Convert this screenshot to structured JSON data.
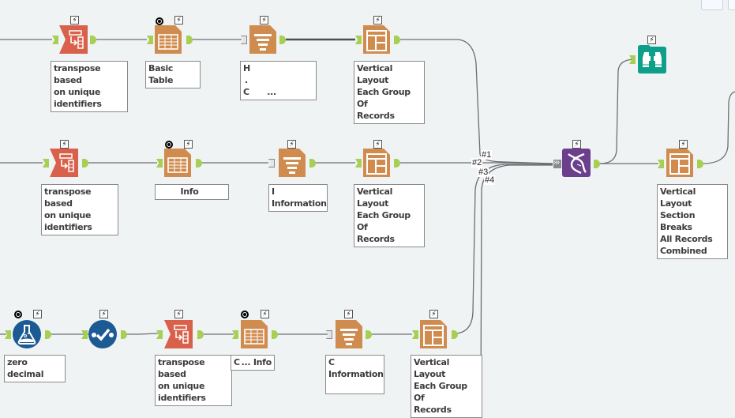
{
  "canvas": {
    "background": "#f0f3f4",
    "colors": {
      "transpose": "#d9604a",
      "reporting": "#d08b4f",
      "union": "#6b3f8c",
      "browse": "#0e9f8b",
      "prep": "#1b5a92",
      "anchor": "#a6cf53"
    }
  },
  "tools": [
    {
      "id": "t1",
      "type": "transpose",
      "icon": "transpose-icon",
      "label": "transpose based on unique identifiers",
      "bolt": "⚡"
    },
    {
      "id": "t2",
      "type": "table",
      "icon": "table-icon",
      "label": "Basic Table",
      "bolt": "⚡",
      "query": true
    },
    {
      "id": "t3",
      "type": "text",
      "icon": "report-text-icon",
      "label": "H... ... C... ...",
      "bolt": "⚡"
    },
    {
      "id": "t4",
      "type": "layout",
      "icon": "layout-icon",
      "label": "Vertical Layout Each Group Of Records",
      "bolt": "⚡"
    },
    {
      "id": "t5",
      "type": "transpose",
      "icon": "transpose-icon",
      "label": "transpose based on unique identifiers",
      "bolt": "⚡"
    },
    {
      "id": "t6",
      "type": "table",
      "icon": "table-icon",
      "label": "... Info",
      "bolt": "⚡",
      "query": true
    },
    {
      "id": "t7",
      "type": "text",
      "icon": "report-text-icon",
      "label": "... Information",
      "bolt": "⚡"
    },
    {
      "id": "t8",
      "type": "layout",
      "icon": "layout-icon",
      "label": "Vertical Layout Each Group Of Records",
      "bolt": "⚡"
    },
    {
      "id": "t9",
      "type": "union",
      "icon": "union-dna-icon",
      "label": "",
      "bolt": "⚡"
    },
    {
      "id": "t10",
      "type": "browse",
      "icon": "binoculars-icon",
      "label": "",
      "bolt": "⚡"
    },
    {
      "id": "t11",
      "type": "layout",
      "icon": "layout-icon",
      "label": "Vertical Layout Section Breaks All Records Combined",
      "bolt": "⚡"
    },
    {
      "id": "t12",
      "type": "formula",
      "icon": "flask-icon",
      "label": "zero decimal",
      "bolt": "⚡",
      "query": true
    },
    {
      "id": "t13",
      "type": "select",
      "icon": "select-check-icon",
      "label": "",
      "bolt": "⚡"
    },
    {
      "id": "t14",
      "type": "transpose",
      "icon": "transpose-icon",
      "label": "transpose based on unique identifiers",
      "bolt": "⚡"
    },
    {
      "id": "t15",
      "type": "table",
      "icon": "table-icon",
      "label": "C... Info",
      "bolt": "⚡",
      "query": true
    },
    {
      "id": "t16",
      "type": "text",
      "icon": "report-text-icon",
      "label": "C... Information ...",
      "bolt": "⚡"
    },
    {
      "id": "t17",
      "type": "layout",
      "icon": "layout-icon",
      "label": "Vertical Layout Each Group Of Records",
      "bolt": "⚡"
    }
  ],
  "labels": {
    "t1": [
      "transpose based",
      "on unique",
      "identifiers"
    ],
    "t2": [
      "Basic Table"
    ],
    "t3": [
      "H        ",
      " .",
      "C           ..."
    ],
    "t4": [
      "Vertical Layout",
      "Each Group Of",
      "Records"
    ],
    "t5": [
      "transpose based",
      "on unique",
      "identifiers"
    ],
    "t6": [
      "               Info"
    ],
    "t7": [
      "I",
      "Information"
    ],
    "t8": [
      "Vertical Layout",
      "Each Group Of",
      "Records"
    ],
    "t11": [
      "Vertical Layout",
      "Section Breaks",
      "All Records",
      "Combined"
    ],
    "t12": [
      "zero decimal"
    ],
    "t14": [
      "transpose based",
      "on unique",
      "identifiers"
    ],
    "t15": [
      "C ... Info"
    ],
    "t16": [
      "C",
      "Information",
      " "
    ],
    "t17": [
      "Vertical Layout",
      "Each Group Of",
      "Records"
    ]
  },
  "connection_tags": [
    "#1",
    "#2",
    "#3",
    "#4"
  ]
}
